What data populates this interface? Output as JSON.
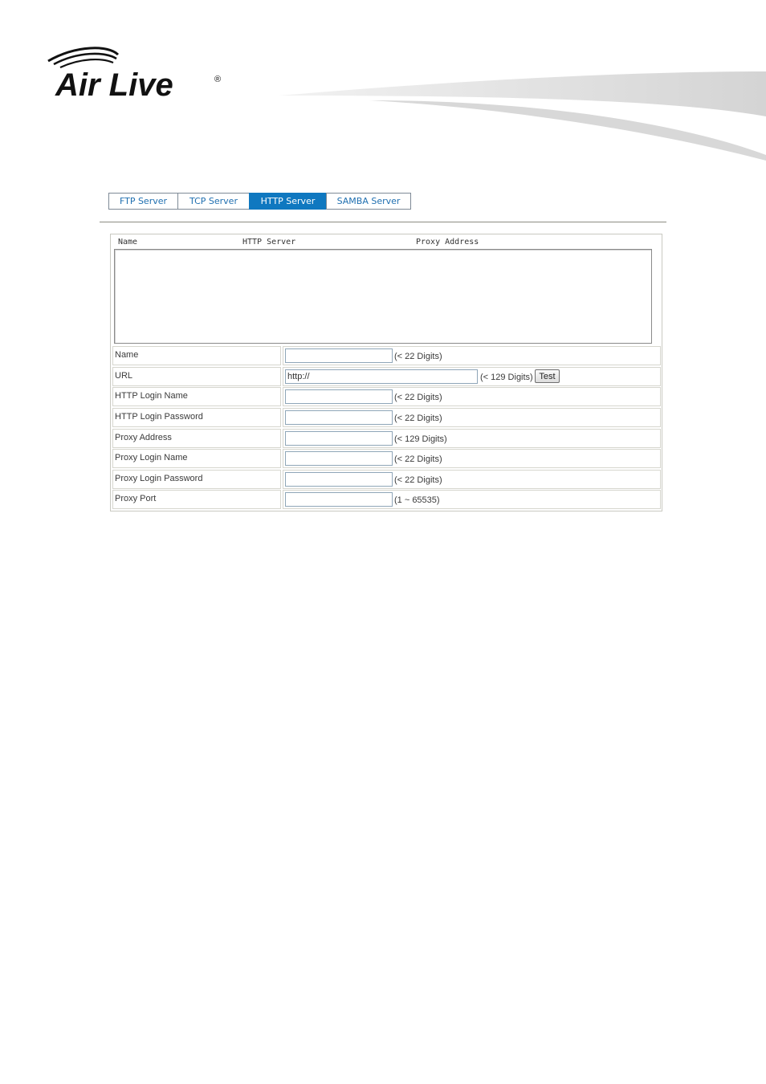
{
  "brand": {
    "logo_text": "Air Live",
    "logo_mark": "®"
  },
  "tabs": [
    {
      "label": "FTP Server",
      "active": false
    },
    {
      "label": "TCP Server",
      "active": false
    },
    {
      "label": "HTTP Server",
      "active": true
    },
    {
      "label": "SAMBA Server",
      "active": false
    }
  ],
  "list": {
    "columns": [
      "Name",
      "HTTP Server",
      "Proxy Address"
    ],
    "rows": []
  },
  "form": {
    "name": {
      "label": "Name",
      "value": "",
      "hint": "(< 22 Digits)"
    },
    "url": {
      "label": "URL",
      "value": "http://",
      "hint": "(< 129 Digits)",
      "button": "Test"
    },
    "http_login_name": {
      "label": "HTTP Login Name",
      "value": "",
      "hint": "(< 22 Digits)"
    },
    "http_login_password": {
      "label": "HTTP Login Password",
      "value": "",
      "hint": "(< 22 Digits)"
    },
    "proxy_address": {
      "label": "Proxy Address",
      "value": "",
      "hint": "(< 129 Digits)"
    },
    "proxy_login_name": {
      "label": "Proxy Login Name",
      "value": "",
      "hint": "(< 22 Digits)"
    },
    "proxy_login_password": {
      "label": "Proxy Login Password",
      "value": "",
      "hint": "(< 22 Digits)"
    },
    "proxy_port": {
      "label": "Proxy Port",
      "value": "",
      "hint": "(1 ~ 65535)"
    }
  },
  "colors": {
    "accent": "#0f78c0",
    "tab_text": "#1f6fb0",
    "border": "#d6d6ce"
  }
}
